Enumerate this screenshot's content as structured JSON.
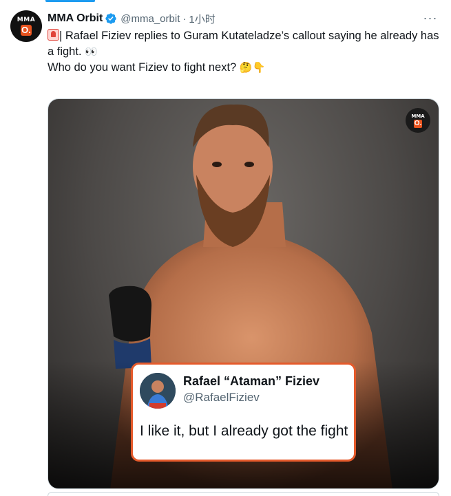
{
  "tweet": {
    "display_name": "MMA Orbit",
    "handle": "@mma_orbit",
    "separator": "·",
    "time": "1小时",
    "more_label": "···",
    "avatar_logo_top": "MMA",
    "avatar_logo_mark": "O.",
    "text_line1": "| Rafael Fiziev replies to Guram Kutateladze’s callout saying he already has a fight.",
    "text_eyes_emoji": "👀",
    "text_question": "Who do you want Fiziev to fight next?",
    "text_question_emoji": "🤔👇",
    "siren_icon": "siren-icon",
    "verified_color": "#1d9bf0"
  },
  "media": {
    "watermark_top": "MMA",
    "watermark_mark": "O.",
    "quote": {
      "name": "Rafael “Ataman” Fiziev",
      "handle": "@RafaelFiziev",
      "text": "I like it, but I already got the fight",
      "border_color": "#e55a2b"
    }
  },
  "colors": {
    "accent": "#1d9bf0",
    "brand_orange": "#e8541f",
    "secondary_text": "#536471"
  }
}
